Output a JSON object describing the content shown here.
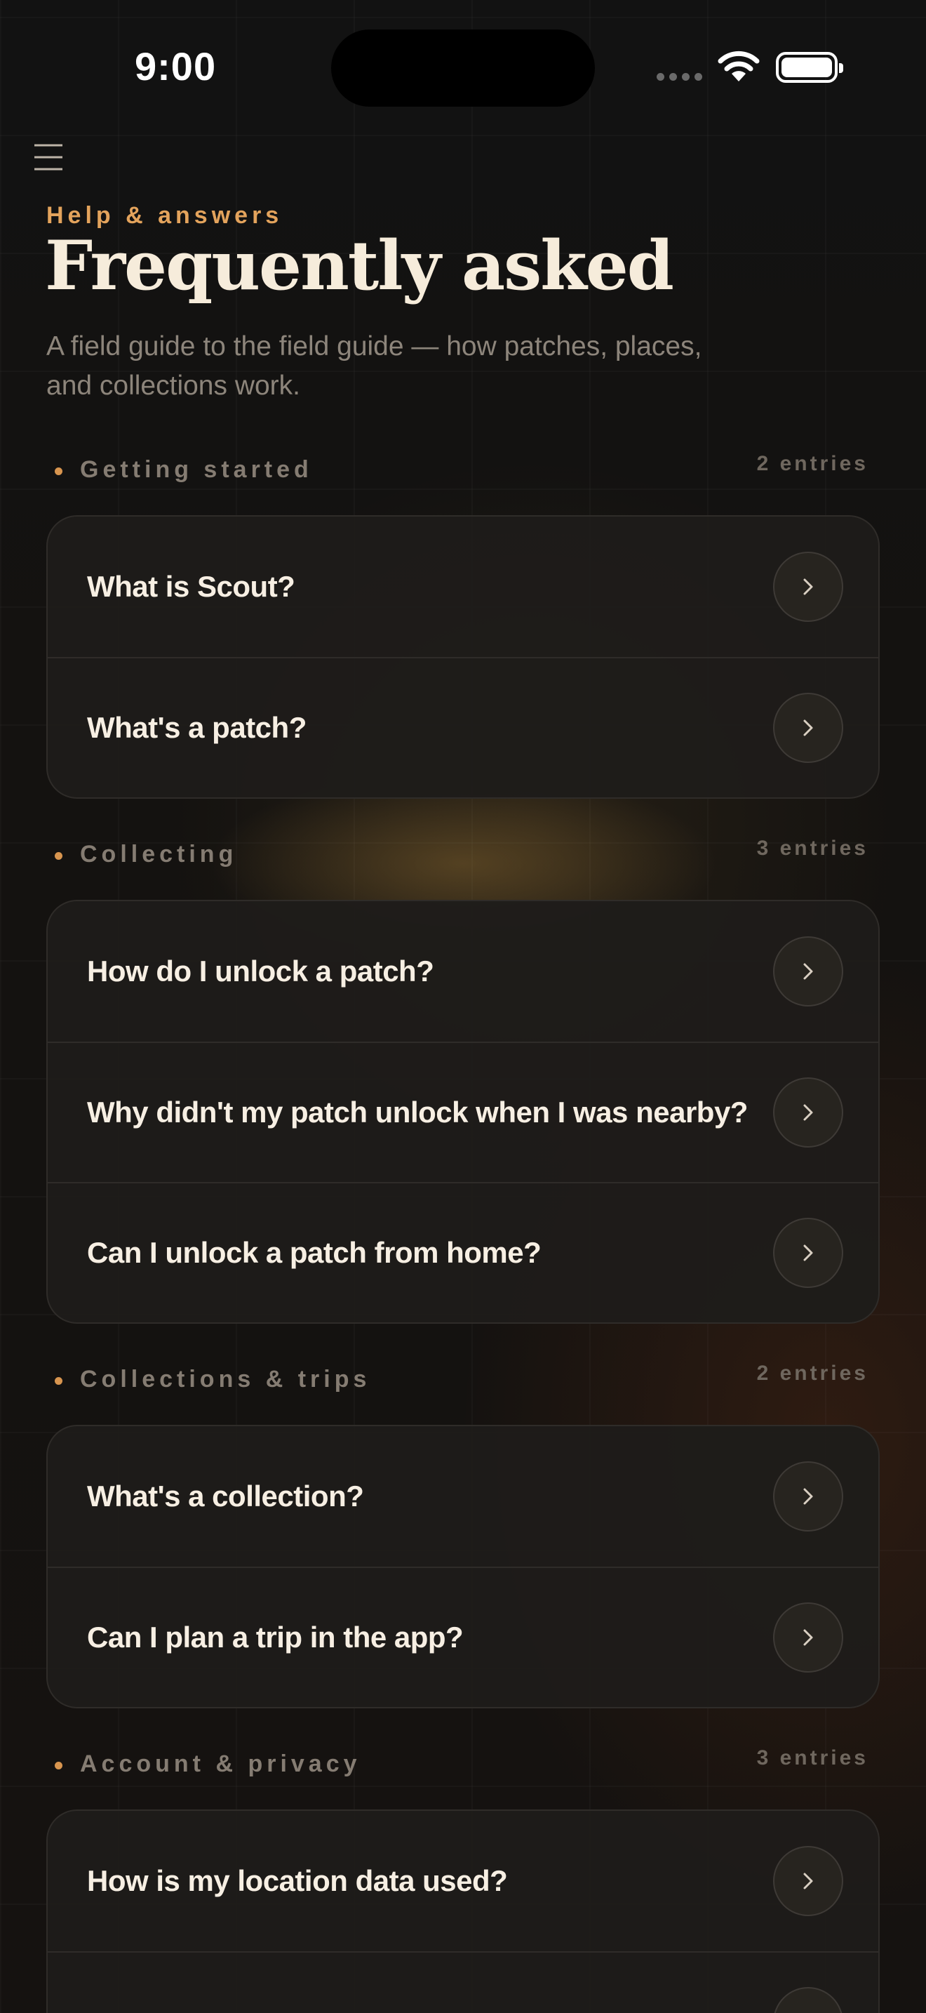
{
  "status_bar": {
    "time": "9:00",
    "icons": [
      "signal-dots-icon",
      "wifi-icon",
      "battery-icon"
    ]
  },
  "header": {
    "menu_icon": "hamburger-menu-icon",
    "eyebrow": "Help & answers",
    "title": "Frequently asked",
    "subtitle": "A field guide to the field guide — how patches, places, and collections work."
  },
  "colors": {
    "accent": "#e3a35c",
    "background": "#121110",
    "card": "#1e1c1a",
    "text": "#f7efe3",
    "muted": "#8d857b"
  },
  "sections": [
    {
      "label": "Getting started",
      "count": "2 entries",
      "items": [
        {
          "question": "What is Scout?"
        },
        {
          "question": "What's a patch?"
        }
      ]
    },
    {
      "label": "Collecting",
      "count": "3 entries",
      "items": [
        {
          "question": "How do I unlock a patch?"
        },
        {
          "question": "Why didn't my patch unlock when I was nearby?"
        },
        {
          "question": "Can I unlock a patch from home?"
        }
      ]
    },
    {
      "label": "Collections & trips",
      "count": "2 entries",
      "items": [
        {
          "question": "What's a collection?"
        },
        {
          "question": "Can I plan a trip in the app?"
        }
      ]
    },
    {
      "label": "Account & privacy",
      "count": "3 entries",
      "items": [
        {
          "question": "How is my location data used?"
        },
        {
          "question": ""
        }
      ]
    }
  ]
}
